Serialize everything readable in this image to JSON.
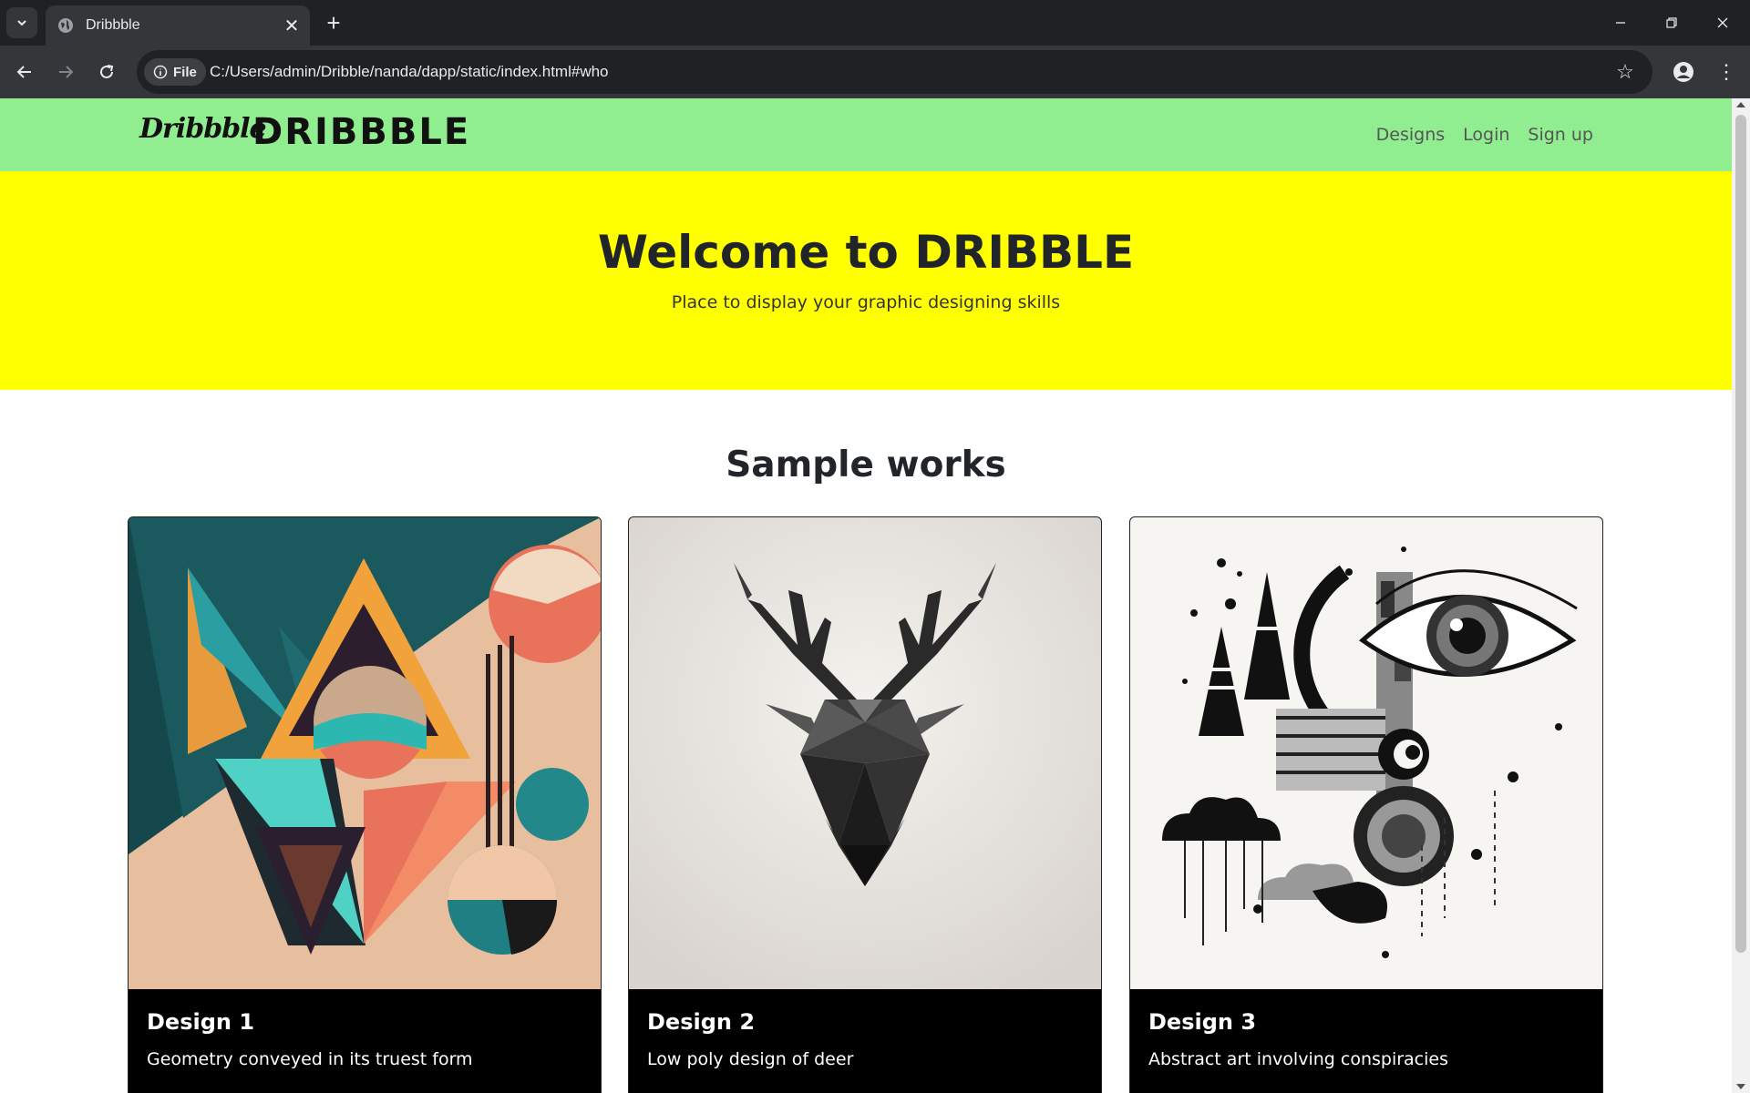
{
  "browser": {
    "tab_title": "Dribbble",
    "new_tab": "+",
    "address_chip": "File",
    "url": "C:/Users/admin/Dribble/nanda/dapp/static/index.html#who"
  },
  "site": {
    "logo_script": "Dribbble",
    "brand": "DRIBBBLE",
    "nav": [
      "Designs",
      "Login",
      "Sign up"
    ]
  },
  "hero": {
    "title": "Welcome to DRIBBLE",
    "subtitle": "Place to display your graphic designing skills"
  },
  "section": {
    "title": "Sample works"
  },
  "cards": [
    {
      "title": "Design 1",
      "text": "Geometry conveyed in its truest form",
      "image": "abstract-geometric-art"
    },
    {
      "title": "Design 2",
      "text": "Low poly design of deer",
      "image": "low-poly-deer"
    },
    {
      "title": "Design 3",
      "text": "Abstract art involving conspiracies",
      "image": "abstract-eye-collage"
    }
  ],
  "colors": {
    "nav_bg": "#90ee90",
    "hero_bg": "#ffff00",
    "card_body_bg": "#000000"
  }
}
